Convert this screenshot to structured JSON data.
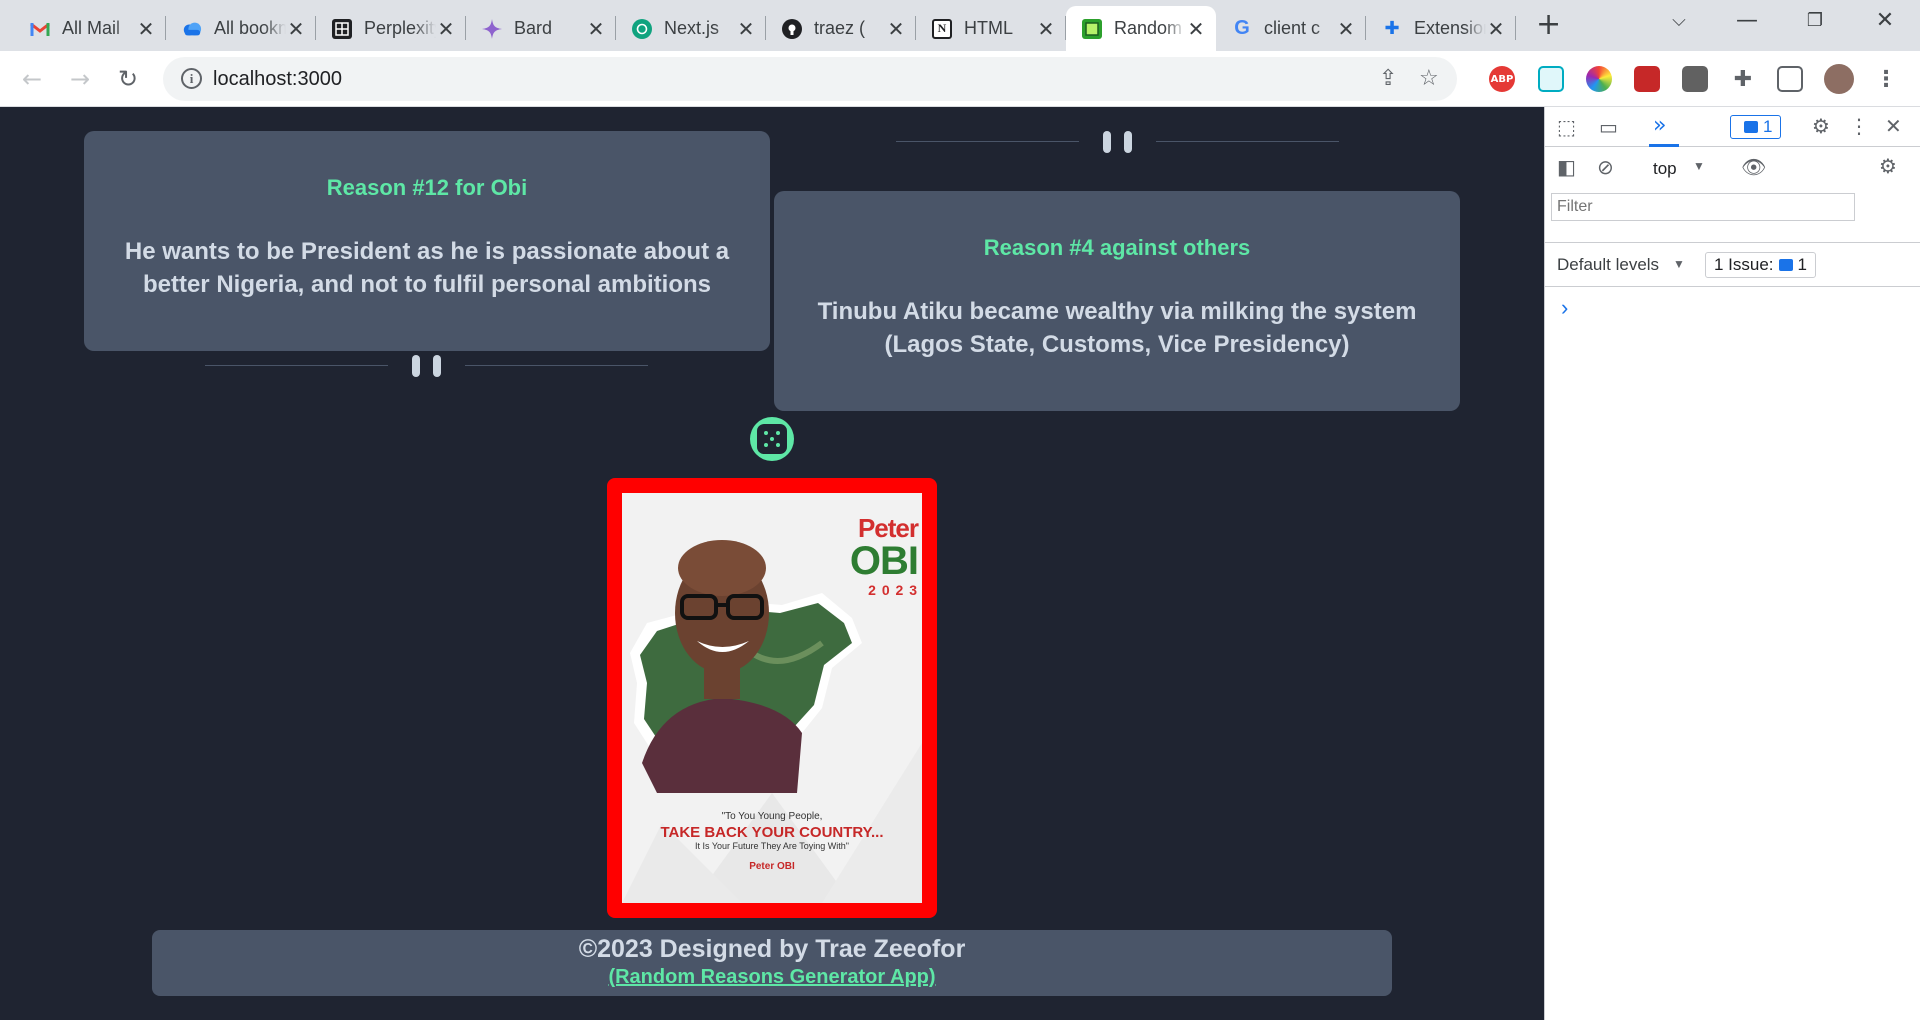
{
  "browser": {
    "tabs": [
      {
        "title": "All Mail",
        "icon": "gmail-icon",
        "color": "#ea4335"
      },
      {
        "title": "All bookmarks",
        "icon": "cloud-icon",
        "color": "#1a73e8"
      },
      {
        "title": "Perplexity",
        "icon": "perplexity-icon",
        "color": "#202124"
      },
      {
        "title": "Bard",
        "icon": "bard-sparkle-icon",
        "color": "#8e63ce"
      },
      {
        "title": "Next.js",
        "icon": "chatgpt-icon",
        "color": "#10a37f"
      },
      {
        "title": "traez (",
        "icon": "github-icon",
        "color": "#202124"
      },
      {
        "title": "HTML",
        "icon": "notion-icon",
        "color": "#202124"
      },
      {
        "title": "Random",
        "icon": "app-favicon-icon",
        "color": "#2ca02c",
        "active": true
      },
      {
        "title": "client c",
        "icon": "google-icon",
        "color": "#4285f4"
      },
      {
        "title": "Extensions",
        "icon": "puzzle-icon",
        "color": "#1a73e8"
      }
    ],
    "url": "localhost:3000"
  },
  "page": {
    "card_left": {
      "heading": "Reason #12 for Obi",
      "body": "He wants to be President as he is passionate about a better Nigeria, and not to fulfil personal ambitions"
    },
    "card_right": {
      "heading": "Reason #4 against others",
      "body": "Tinubu Atiku became wealthy via milking the system (Lagos State, Customs, Vice Presidency)"
    },
    "poster": {
      "name_first": "Peter",
      "name_last": "OBI",
      "year": "2 0 2 3",
      "quote_top": "\"To You Young People,",
      "quote_main": "TAKE BACK YOUR COUNTRY...",
      "quote_bottom": "It Is Your Future They Are Toying With\"",
      "signature": "Peter OBI"
    },
    "footer": {
      "copyright": "©2023 Designed by Trae Zeeofor",
      "link": "(Random Reasons Generator App)"
    },
    "colors": {
      "accent": "#5ee7a6",
      "card": "#4a5568",
      "background": "#1f2431",
      "poster_frame": "#ff0000"
    }
  },
  "devtools": {
    "issues_count": "1",
    "context": "top",
    "filter_placeholder": "Filter",
    "levels": "Default levels",
    "issues_label": "1 Issue:",
    "issues_badge": "1",
    "prompt": "›"
  }
}
